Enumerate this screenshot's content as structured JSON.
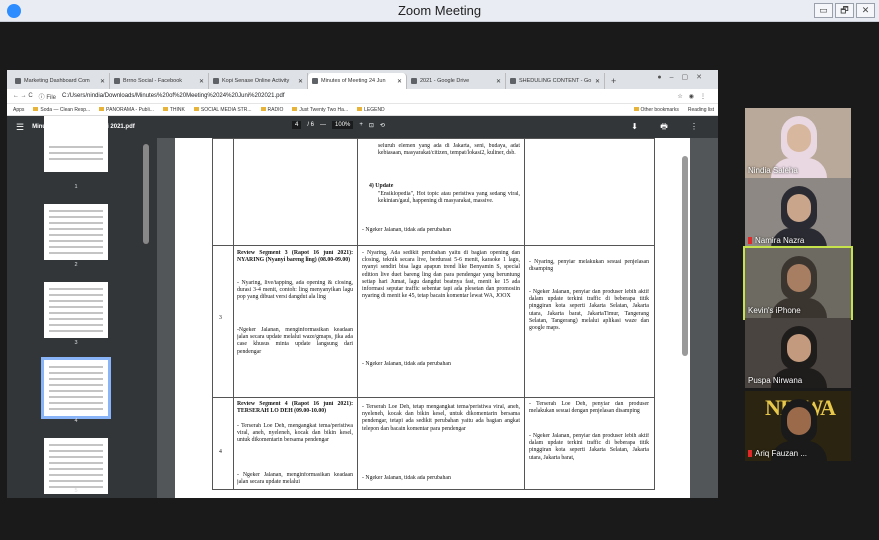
{
  "window": {
    "title": "Zoom Meeting",
    "controls": [
      "▭",
      "🗗",
      "✕"
    ]
  },
  "browser": {
    "tabs": [
      {
        "label": "Marketing Dashboard Com"
      },
      {
        "label": "Brrno Social - Facebook"
      },
      {
        "label": "Kopi Senase Online Activity"
      },
      {
        "label": "Minutes of Meeting 24 Jun"
      },
      {
        "label": "2021 - Google Drive"
      },
      {
        "label": "SHEDULING CONTENT - Go"
      }
    ],
    "new_tab": "+",
    "address": {
      "nav": "←  →  C",
      "prefix": "ⓘ File",
      "url": "C:/Users/nindia/Downloads/Minutes%20of%20Meeting%2024%20Juni%202021.pdf"
    },
    "bookmarks": [
      "Apps",
      "Soda — Clean Resp...",
      "PANORAMA - Publi...",
      "THINK",
      "SOCIAL MEDIA STR...",
      "RADIO",
      "Just Twenty Two Ha...",
      "LEGEND"
    ],
    "bookmarks_right": [
      "Other bookmarks",
      "Reading list"
    ]
  },
  "pdf": {
    "menu_icon": "☰",
    "filename": "Minutes of Meeting 24 Juni 2021.pdf",
    "page_current": "4",
    "page_total": "/ 6",
    "zoom": "100%",
    "zoom_out": "—",
    "zoom_in": "+",
    "right_icons": "⬇ 🖶 ⋮",
    "thumb_numbers": [
      "1",
      "2",
      "3",
      "4",
      "5"
    ],
    "rows": [
      {
        "num": "",
        "segment": "",
        "changes": [
          "seluruh elemen yang ada di Jakarta, seni, budaya, adat kebiasaan, masyarakat/citizen, tempat/lokasi2, kuliner, dsb.",
          "4)  Update",
          "\"Ensiklopedia\", Hot topic atau peristiwa yang sedang viral, kekinian/gaul, happening di masyarakat, massive.",
          "- Ngeker Jalanan, tidak ada perubahan"
        ],
        "notes": ""
      },
      {
        "num": "3",
        "segment_title": "Review Segment 3 (Rapot 16 juni 2021): NYARING (Nyanyi bareng ling) (08.00-09.00)",
        "segment_body": "- Nyaring, live/tapping, ada opening & closing, durasi 3-4 menit, contoh: ling menyanyikan lagu pop yang dibuat versi dangdut ala ling",
        "segment_body2": "-Ngeker Jalanan, menginformasikan keadaan jalan secara update melalui waze/gmaps, jika ada case khusus minta update langsung dari pendengar",
        "changes_a": "- Nyaring, Ada sedikit perubahan yaitu di bagian opening dan closing, teknik secara live, berdurasi 5-6 menit, karaoke 1 lagu, nyanyi sendiri bisa lagu apapun trend like Benyamin S, special edition live duet bareng ling dan para pendengar yang beruntung setiap hari Jumat, lagu dangdut beatnya fast, menit ke 15 ada informasi seputar traffic sebentar tapi ada plesetan dan promosiin nyaring di menit ke 45, tetap bacain komentar lewat WA, JOOX",
        "changes_b": "- Ngeker Jalanan, tidak ada perubahan",
        "notes_a": "- Nyaring, penyiar melakukan sesuai penjelasan disamping",
        "notes_b": "- Ngeker Jalanan, penyiar dan produser lebih aktif dalam update terkini traffic di beberapa titik pinggiran kota seperti Jakarta Selatan, Jakarta utara, Jakarta barat, JakartaTimur, Tangerang Selatan, Tangerang) melalui aplikasi waze dan google maps."
      },
      {
        "num": "4",
        "segment_title": "Review Segment 4 (Rapot 16 juni 2021): TERSERAH LO DEH (09.00-10.00)",
        "segment_body": "- Terserah Loe Deh, mengangkat tema/peristiwa viral, aneh, nyeleneh, kocak dan bikin kesel, untuk dikomentarin bersama pendengar",
        "segment_body2": "- Ngeker Jalanan, menginformasikan keadaan jalan secara update melalui",
        "changes_a": "- Terserah Loe Deh, tetap mengangkat tema/peristiwa viral, aneh, nyeleneh, kocak dan bikin kesel, untuk dikomentarin bersama pendengar, tetapi ada sedikit perubahan yaitu ada bagian angkat telepon dan bacain komentar para pendengar",
        "changes_b": "- Ngeker Jalanan, tidak ada perubahan",
        "notes_a": "- Terserah Loe Deh, penyiar dan produser melakukan sesuai dengan penjelasan disamping",
        "notes_b": "- Ngeker Jalanan, penyiar dan produser lebih aktif dalam update terkini traffic di beberapa titik pinggiran kota seperti Jakarta Selatan, Jakarta utara, Jakarta barat,"
      }
    ]
  },
  "participants": [
    {
      "name": "Nindia Saleha",
      "muted": false,
      "active": false,
      "bg": "#b9a99a",
      "skin": "#d7b79d",
      "hijab": "#e9d8e2"
    },
    {
      "name": "Namira Nazra",
      "muted": true,
      "active": false,
      "bg": "#8d8883",
      "skin": "#c8a58b",
      "hijab": "#2a2a32"
    },
    {
      "name": "Kevin's iPhone",
      "muted": false,
      "active": true,
      "bg": "#6d6a61",
      "skin": "#a87e63",
      "hijab": "#3b3530"
    },
    {
      "name": "Puspa Nirwana",
      "muted": false,
      "active": false,
      "bg": "#4a4440",
      "skin": "#c39a7d",
      "hijab": "#1f1c1c"
    },
    {
      "name": "Ariq Fauzan ...",
      "muted": true,
      "active": false,
      "bg": "#2b2410",
      "skin": "#9b6a4b",
      "hijab": "#1a1a1a",
      "poster": "NIRWA"
    }
  ]
}
